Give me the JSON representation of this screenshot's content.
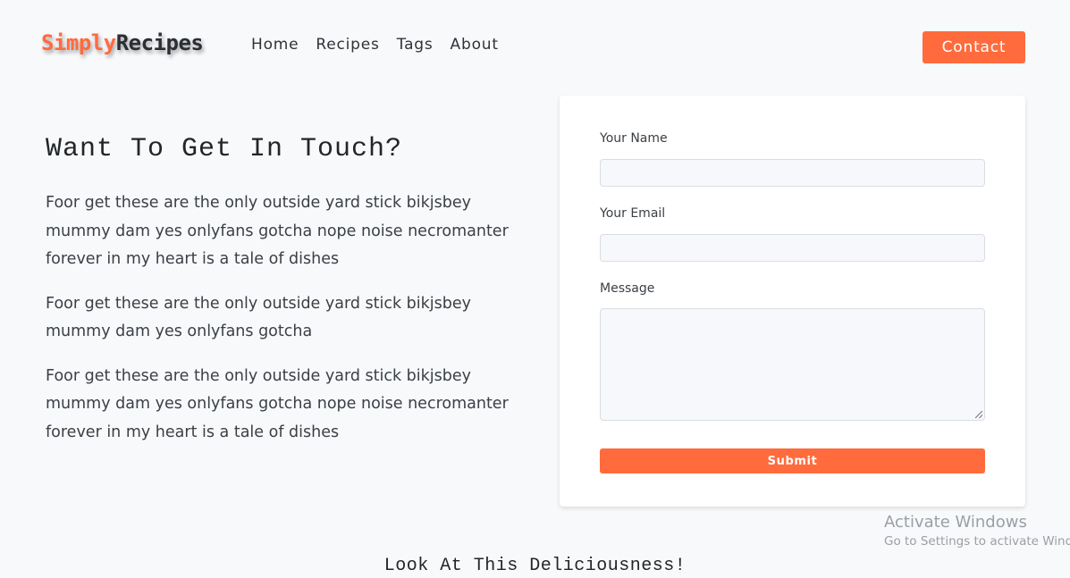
{
  "navbar": {
    "logo_part1": "Simply",
    "logo_part2": "Recipes",
    "links": [
      {
        "label": "Home"
      },
      {
        "label": "Recipes"
      },
      {
        "label": "Tags"
      },
      {
        "label": "About"
      }
    ],
    "contact_label": "Contact",
    "accent_color": "#ff6b3d"
  },
  "info": {
    "title": "Want To Get In Touch?",
    "paragraphs": [
      "Foor get these are the only outside yard stick bikjsbey mummy dam yes onlyfans gotcha nope noise necromanter forever in my heart is a tale of dishes",
      "Foor get these are the only outside yard stick bikjsbey mummy dam yes onlyfans gotcha",
      "Foor get these are the only outside yard stick bikjsbey mummy dam yes onlyfans gotcha nope noise necromanter forever in my heart is a tale of dishes"
    ]
  },
  "form": {
    "name_label": "Your Name",
    "name_value": "",
    "email_label": "Your Email",
    "email_value": "",
    "message_label": "Message",
    "message_value": "",
    "submit_label": "Submit"
  },
  "watermark": {
    "title": "Activate Windows",
    "subtitle": "Go to Settings to activate Windows."
  },
  "section": {
    "heading": "Look At This Deliciousness!"
  }
}
